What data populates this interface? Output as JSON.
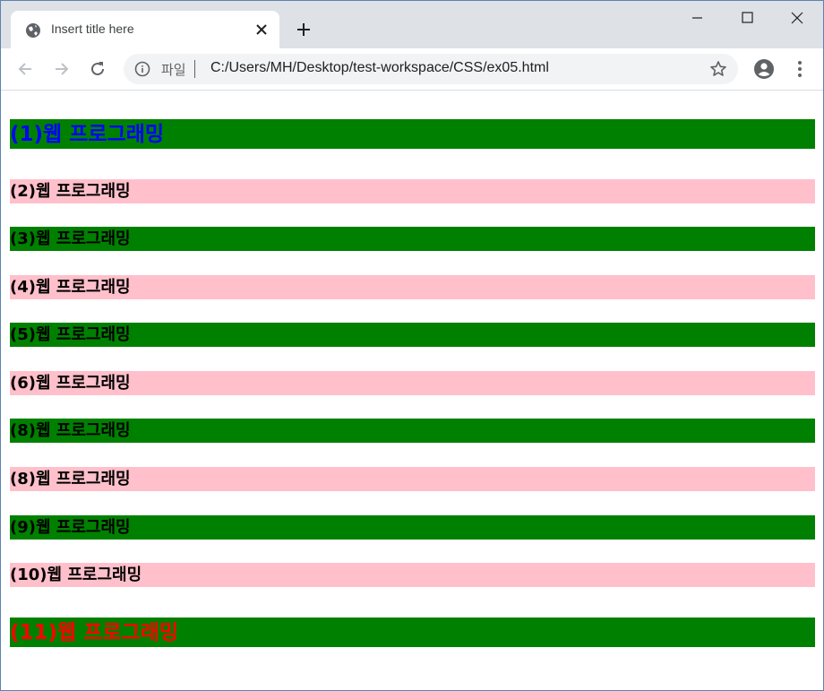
{
  "browser": {
    "tab_title": "Insert title here",
    "address_scheme": "파일",
    "address_url": "C:/Users/MH/Desktop/test-workspace/CSS/ex05.html"
  },
  "icons": {
    "tab_favicon": "globe-icon",
    "tab_close": "close-icon",
    "new_tab": "plus-icon",
    "minimize": "minimize-icon",
    "maximize": "maximize-icon",
    "window_close": "close-icon",
    "back": "back-arrow-icon",
    "forward": "forward-arrow-icon",
    "reload": "reload-icon",
    "site_info": "info-icon",
    "bookmark": "star-icon",
    "account": "account-icon",
    "menu": "kebab-menu-icon"
  },
  "colors": {
    "green": "#008000",
    "pink": "#ffc0cb",
    "blue_text": "#0000ff",
    "red_text": "#ff0000"
  },
  "headings": [
    {
      "text": "(1)웹 프로그래밍",
      "background": "green",
      "text_color": "blue"
    },
    {
      "text": "(2)웹 프로그래밍",
      "background": "pink",
      "text_color": "black"
    },
    {
      "text": "(3)웹 프로그래밍",
      "background": "green",
      "text_color": "black"
    },
    {
      "text": "(4)웹 프로그래밍",
      "background": "pink",
      "text_color": "black"
    },
    {
      "text": "(5)웹 프로그래밍",
      "background": "green",
      "text_color": "black"
    },
    {
      "text": "(6)웹 프로그래밍",
      "background": "pink",
      "text_color": "black"
    },
    {
      "text": "(8)웹 프로그래밍",
      "background": "green",
      "text_color": "black"
    },
    {
      "text": "(8)웹 프로그래밍",
      "background": "pink",
      "text_color": "black"
    },
    {
      "text": "(9)웹 프로그래밍",
      "background": "green",
      "text_color": "black"
    },
    {
      "text": "(10)웹 프로그래밍",
      "background": "pink",
      "text_color": "black"
    },
    {
      "text": "(11)웹 프로그래밍",
      "background": "green",
      "text_color": "red"
    }
  ]
}
